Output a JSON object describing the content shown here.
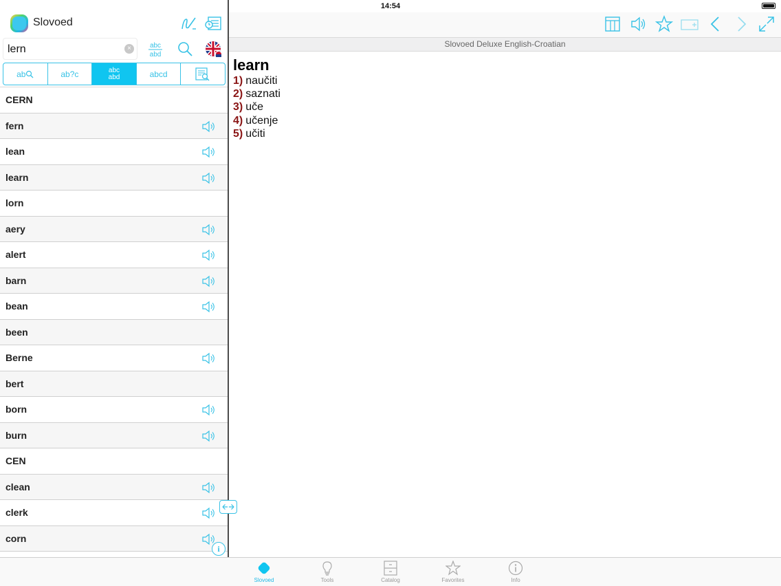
{
  "status_bar": {
    "time": "14:54"
  },
  "app": {
    "title": "Slovoed"
  },
  "search": {
    "value": "lern",
    "clear_icon": "clear-icon"
  },
  "modes": [
    {
      "label": "ab",
      "icon": "search-icon"
    },
    {
      "label": "ab?c"
    },
    {
      "label": "abc abd",
      "active": true
    },
    {
      "label": "abcd"
    },
    {
      "label": "",
      "icon": "fulltext-icon"
    }
  ],
  "word_list": [
    {
      "word": "CERN",
      "audio": false
    },
    {
      "word": "fern",
      "audio": true
    },
    {
      "word": "lean",
      "audio": true
    },
    {
      "word": "learn",
      "audio": true
    },
    {
      "word": "lorn",
      "audio": false
    },
    {
      "word": "aery",
      "audio": true
    },
    {
      "word": "alert",
      "audio": true
    },
    {
      "word": "barn",
      "audio": true
    },
    {
      "word": "bean",
      "audio": true
    },
    {
      "word": "been",
      "audio": false
    },
    {
      "word": "Berne",
      "audio": true
    },
    {
      "word": "bert",
      "audio": false
    },
    {
      "word": "born",
      "audio": true
    },
    {
      "word": "burn",
      "audio": true
    },
    {
      "word": "CEN",
      "audio": false
    },
    {
      "word": "clean",
      "audio": true
    },
    {
      "word": "clerk",
      "audio": true
    },
    {
      "word": "corn",
      "audio": true
    }
  ],
  "dictionary": {
    "name": "Slovoed Deluxe English-Croatian"
  },
  "entry": {
    "headword": "learn",
    "senses": [
      {
        "num": "1)",
        "text": "naučiti"
      },
      {
        "num": "2)",
        "text": "saznati"
      },
      {
        "num": "3)",
        "text": "uče"
      },
      {
        "num": "4)",
        "text": "učenje"
      },
      {
        "num": "5)",
        "text": "učiti"
      }
    ]
  },
  "tabs": [
    {
      "label": "Slovoed",
      "icon": "slovoed-logo-icon",
      "active": true
    },
    {
      "label": "Tools",
      "icon": "lightbulb-icon"
    },
    {
      "label": "Catalog",
      "icon": "cabinet-icon"
    },
    {
      "label": "Favorites",
      "icon": "star-icon"
    },
    {
      "label": "Info",
      "icon": "info-icon"
    }
  ],
  "colors": {
    "accent": "#38c2e6",
    "active_tab": "#10c5f0",
    "sense_number": "#8a1414"
  }
}
